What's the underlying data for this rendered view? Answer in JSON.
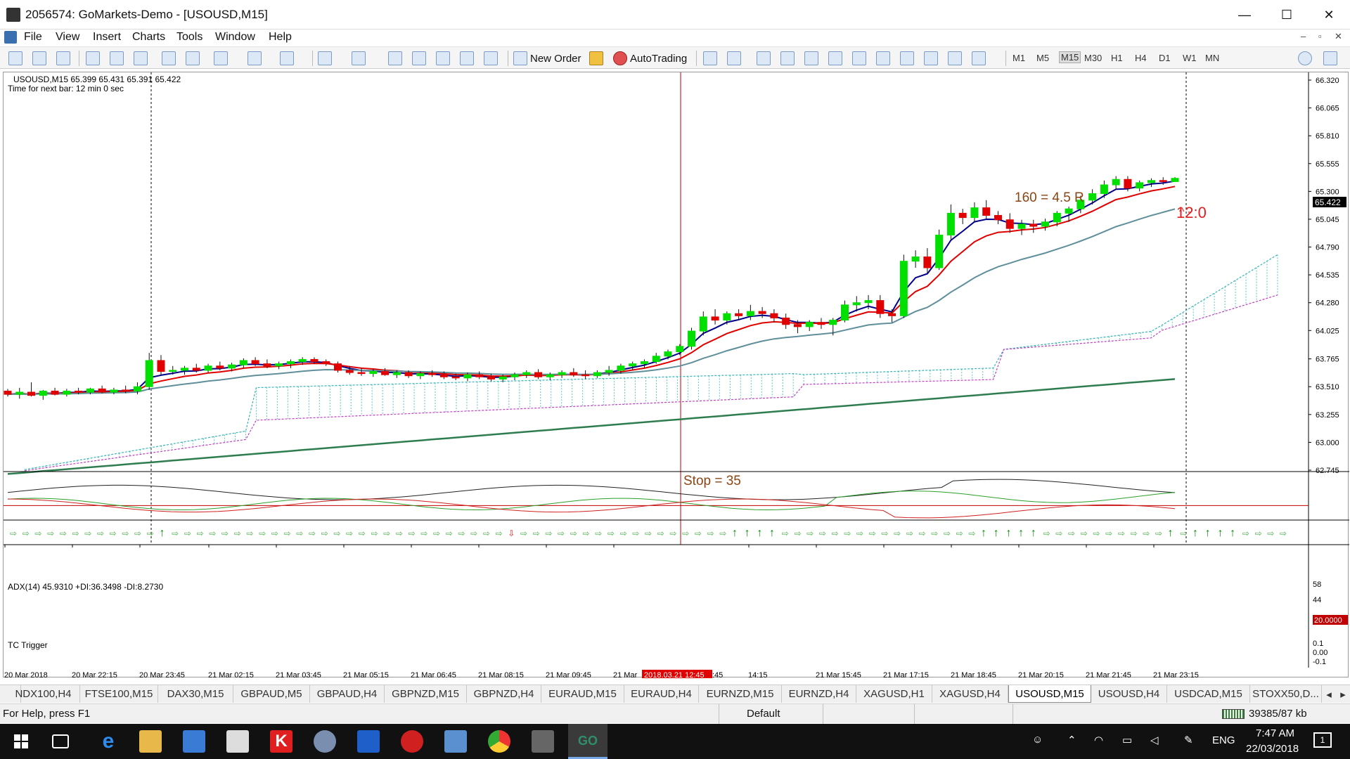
{
  "window": {
    "title": "2056574: GoMarkets-Demo - [USOUSD,M15]",
    "minimize": "—",
    "maximize": "☐",
    "close": "✕"
  },
  "menu": [
    "File",
    "View",
    "Insert",
    "Charts",
    "Tools",
    "Window",
    "Help"
  ],
  "toolbar": {
    "new_order": "New Order",
    "autotrading": "AutoTrading",
    "timeframes": [
      "M1",
      "M5",
      "M15",
      "M30",
      "H1",
      "H4",
      "D1",
      "W1",
      "MN"
    ],
    "active_timeframe": "M15"
  },
  "chart": {
    "symbol_line": "USOUSD,M15  65.399 65.431 65.391 65.422",
    "next_bar": "Time for next bar: 12 min 0 sec",
    "annotation_target": "160 = 4.5 R",
    "annotation_stop": "Stop = 35",
    "countdown": "12:0",
    "current_price": "65.422",
    "price_ticks": [
      "66.320",
      "66.065",
      "65.810",
      "65.555",
      "65.300",
      "65.045",
      "64.790",
      "64.535",
      "64.280",
      "64.025",
      "63.765",
      "63.510",
      "63.255",
      "63.000",
      "62.745"
    ],
    "time_ticks": [
      "20 Mar 2018",
      "20 Mar 22:15",
      "20 Mar 23:45",
      "21 Mar 02:15",
      "21 Mar 03:45",
      "21 Mar 05:15",
      "21 Mar 06:45",
      "21 Mar 08:15",
      "21 Mar 09:45",
      "21 Mar",
      "14:15",
      "21 Mar 15:45",
      "21 Mar 17:15",
      "21 Mar 18:45",
      "21 Mar 20:15",
      "21 Mar 21:45",
      "21 Mar 23:15"
    ],
    "cursor_time": "2018.03.21 12:45",
    "cursor_time_suffix": ":45",
    "adx_label": "ADX(14) 45.9310 +DI:36.3498 -DI:8.2730",
    "adx_ticks": [
      "58",
      "44"
    ],
    "adx_level": "20.0000",
    "tc_label": "TC Trigger",
    "tc_ticks": [
      "0.1",
      "0.00",
      "-0.1"
    ],
    "colors": {
      "bull": "#00e000",
      "bear": "#e00000",
      "ema_fast": "#00008b",
      "ema_slow": "#e00000",
      "ma_mid": "#5f8f9a",
      "ma_long": "#2e7d4f",
      "cloud_top": "#35b5b5",
      "cloud_bottom": "#c040c0",
      "annotation": "#8b4513",
      "countdown": "#e02020"
    },
    "candles": [
      [
        63.47,
        63.49,
        63.42,
        63.44
      ],
      [
        63.44,
        63.5,
        63.4,
        63.46
      ],
      [
        63.46,
        63.55,
        63.42,
        63.43
      ],
      [
        63.43,
        63.48,
        63.39,
        63.47
      ],
      [
        63.47,
        63.5,
        63.43,
        63.44
      ],
      [
        63.44,
        63.49,
        63.42,
        63.47
      ],
      [
        63.47,
        63.5,
        63.44,
        63.46
      ],
      [
        63.46,
        63.5,
        63.44,
        63.49
      ],
      [
        63.49,
        63.52,
        63.45,
        63.46
      ],
      [
        63.46,
        63.5,
        63.44,
        63.48
      ],
      [
        63.48,
        63.52,
        63.45,
        63.47
      ],
      [
        63.47,
        63.55,
        63.44,
        63.51
      ],
      [
        63.51,
        63.82,
        63.48,
        63.75
      ],
      [
        63.75,
        63.8,
        63.62,
        63.65
      ],
      [
        63.65,
        63.7,
        63.62,
        63.66
      ],
      [
        63.66,
        63.7,
        63.62,
        63.68
      ],
      [
        63.68,
        63.72,
        63.64,
        63.66
      ],
      [
        63.66,
        63.72,
        63.64,
        63.7
      ],
      [
        63.7,
        63.74,
        63.66,
        63.68
      ],
      [
        63.68,
        63.73,
        63.65,
        63.71
      ],
      [
        63.71,
        63.77,
        63.68,
        63.75
      ],
      [
        63.75,
        63.78,
        63.7,
        63.72
      ],
      [
        63.72,
        63.76,
        63.68,
        63.7
      ],
      [
        63.7,
        63.74,
        63.67,
        63.72
      ],
      [
        63.72,
        63.76,
        63.68,
        63.74
      ],
      [
        63.74,
        63.78,
        63.71,
        63.76
      ],
      [
        63.76,
        63.78,
        63.72,
        63.74
      ],
      [
        63.74,
        63.76,
        63.7,
        63.72
      ],
      [
        63.72,
        63.74,
        63.64,
        63.66
      ],
      [
        63.66,
        63.7,
        63.62,
        63.64
      ],
      [
        63.64,
        63.68,
        63.61,
        63.63
      ],
      [
        63.63,
        63.67,
        63.6,
        63.65
      ],
      [
        63.65,
        63.68,
        63.61,
        63.62
      ],
      [
        63.62,
        63.66,
        63.59,
        63.64
      ],
      [
        63.64,
        63.66,
        63.59,
        63.61
      ],
      [
        63.61,
        63.65,
        63.58,
        63.63
      ],
      [
        63.63,
        63.66,
        63.6,
        63.62
      ],
      [
        63.62,
        63.65,
        63.58,
        63.6
      ],
      [
        63.6,
        63.63,
        63.57,
        63.59
      ],
      [
        63.59,
        63.64,
        63.56,
        63.62
      ],
      [
        63.62,
        63.65,
        63.58,
        63.6
      ],
      [
        63.6,
        63.63,
        63.56,
        63.58
      ],
      [
        63.58,
        63.62,
        63.55,
        63.6
      ],
      [
        63.6,
        63.64,
        63.57,
        63.62
      ],
      [
        63.62,
        63.66,
        63.59,
        63.64
      ],
      [
        63.64,
        63.67,
        63.58,
        63.6
      ],
      [
        63.6,
        63.64,
        63.57,
        63.62
      ],
      [
        63.62,
        63.66,
        63.59,
        63.64
      ],
      [
        63.64,
        63.68,
        63.6,
        63.62
      ],
      [
        63.62,
        63.66,
        63.58,
        63.61
      ],
      [
        63.61,
        63.66,
        63.59,
        63.64
      ],
      [
        63.64,
        63.7,
        63.61,
        63.66
      ],
      [
        63.66,
        63.72,
        63.63,
        63.7
      ],
      [
        63.7,
        63.74,
        63.66,
        63.72
      ],
      [
        63.72,
        63.76,
        63.68,
        63.74
      ],
      [
        63.74,
        63.82,
        63.72,
        63.79
      ],
      [
        63.79,
        63.85,
        63.76,
        63.83
      ],
      [
        63.83,
        63.9,
        63.8,
        63.88
      ],
      [
        63.88,
        64.05,
        63.85,
        64.02
      ],
      [
        64.02,
        64.2,
        63.98,
        64.15
      ],
      [
        64.15,
        64.22,
        64.08,
        64.12
      ],
      [
        64.12,
        64.2,
        64.08,
        64.18
      ],
      [
        64.18,
        64.22,
        64.12,
        64.16
      ],
      [
        64.16,
        64.26,
        64.12,
        64.2
      ],
      [
        64.2,
        64.24,
        64.14,
        64.18
      ],
      [
        64.18,
        64.22,
        64.1,
        64.14
      ],
      [
        64.14,
        64.18,
        64.04,
        64.08
      ],
      [
        64.08,
        64.12,
        64.0,
        64.06
      ],
      [
        64.06,
        64.12,
        64.02,
        64.1
      ],
      [
        64.1,
        64.14,
        64.04,
        64.08
      ],
      [
        64.08,
        64.14,
        63.98,
        64.12
      ],
      [
        64.12,
        64.3,
        64.1,
        64.26
      ],
      [
        64.26,
        64.34,
        64.2,
        64.28
      ],
      [
        64.28,
        64.35,
        64.22,
        64.3
      ],
      [
        64.3,
        64.35,
        64.14,
        64.18
      ],
      [
        64.18,
        64.22,
        64.1,
        64.16
      ],
      [
        64.16,
        64.72,
        64.14,
        64.66
      ],
      [
        64.66,
        64.76,
        64.6,
        64.7
      ],
      [
        64.7,
        64.78,
        64.55,
        64.6
      ],
      [
        64.6,
        64.95,
        64.58,
        64.9
      ],
      [
        64.9,
        65.18,
        64.86,
        65.1
      ],
      [
        65.1,
        65.14,
        65.0,
        65.06
      ],
      [
        65.06,
        65.2,
        65.02,
        65.15
      ],
      [
        65.15,
        65.22,
        65.05,
        65.08
      ],
      [
        65.08,
        65.12,
        65.0,
        65.04
      ],
      [
        65.04,
        65.1,
        64.92,
        64.96
      ],
      [
        64.96,
        65.04,
        64.9,
        65.0
      ],
      [
        65.0,
        65.04,
        64.92,
        64.98
      ],
      [
        64.98,
        65.05,
        64.94,
        65.02
      ],
      [
        65.02,
        65.12,
        64.98,
        65.1
      ],
      [
        65.1,
        65.16,
        65.02,
        65.14
      ],
      [
        65.14,
        65.26,
        65.1,
        65.22
      ],
      [
        65.22,
        65.32,
        65.18,
        65.28
      ],
      [
        65.28,
        65.4,
        65.24,
        65.36
      ],
      [
        65.36,
        65.44,
        65.32,
        65.41
      ],
      [
        65.41,
        65.44,
        65.3,
        65.33
      ],
      [
        65.33,
        65.4,
        65.3,
        65.38
      ],
      [
        65.38,
        65.42,
        65.34,
        65.4
      ],
      [
        65.4,
        65.43,
        65.36,
        65.39
      ],
      [
        65.39,
        65.43,
        65.39,
        65.42
      ]
    ],
    "tc_signals": [
      "u",
      "u",
      "u",
      "u",
      "u",
      "u",
      "u",
      "u",
      "u",
      "u",
      "u",
      "u",
      "U",
      "u",
      "u",
      "u",
      "u",
      "u",
      "u",
      "u",
      "u",
      "u",
      "u",
      "u",
      "u",
      "u",
      "u",
      "u",
      "u",
      "u",
      "u",
      "u",
      "u",
      "u",
      "u",
      "u",
      "u",
      "u",
      "u",
      "u",
      "d",
      "u",
      "u",
      "u",
      "u",
      "u",
      "u",
      "u",
      "u",
      "u",
      "u",
      "u",
      "u",
      "u",
      "u",
      "u",
      "u",
      "u",
      "U",
      "U",
      "U",
      "U",
      "u",
      "u",
      "u",
      "u",
      "u",
      "u",
      "u",
      "u",
      "u",
      "u",
      "u",
      "u",
      "u",
      "u",
      "u",
      "u",
      "U",
      "U",
      "U",
      "U",
      "U",
      "u",
      "u",
      "u",
      "u",
      "u",
      "u",
      "u",
      "u",
      "u",
      "u",
      "U",
      "u",
      "U",
      "U",
      "U",
      "U",
      "u",
      "u",
      "u",
      "u"
    ]
  },
  "tabs": [
    "NDX100,H4",
    "FTSE100,M15",
    "DAX30,M15",
    "GBPAUD,M5",
    "GBPAUD,H4",
    "GBPNZD,M15",
    "GBPNZD,H4",
    "EURAUD,M15",
    "EURAUD,H4",
    "EURNZD,M15",
    "EURNZD,H4",
    "XAGUSD,H1",
    "XAGUSD,H4",
    "USOUSD,M15",
    "USOUSD,H4",
    "USDCAD,M15",
    "STOXX50,D..."
  ],
  "active_tab": "USOUSD,M15",
  "status": {
    "help": "For Help, press F1",
    "profile": "Default",
    "traffic": "39385/87 kb"
  },
  "taskbar": {
    "lang": "ENG",
    "time": "7:47 AM",
    "date": "22/03/2018",
    "notif": "1"
  }
}
